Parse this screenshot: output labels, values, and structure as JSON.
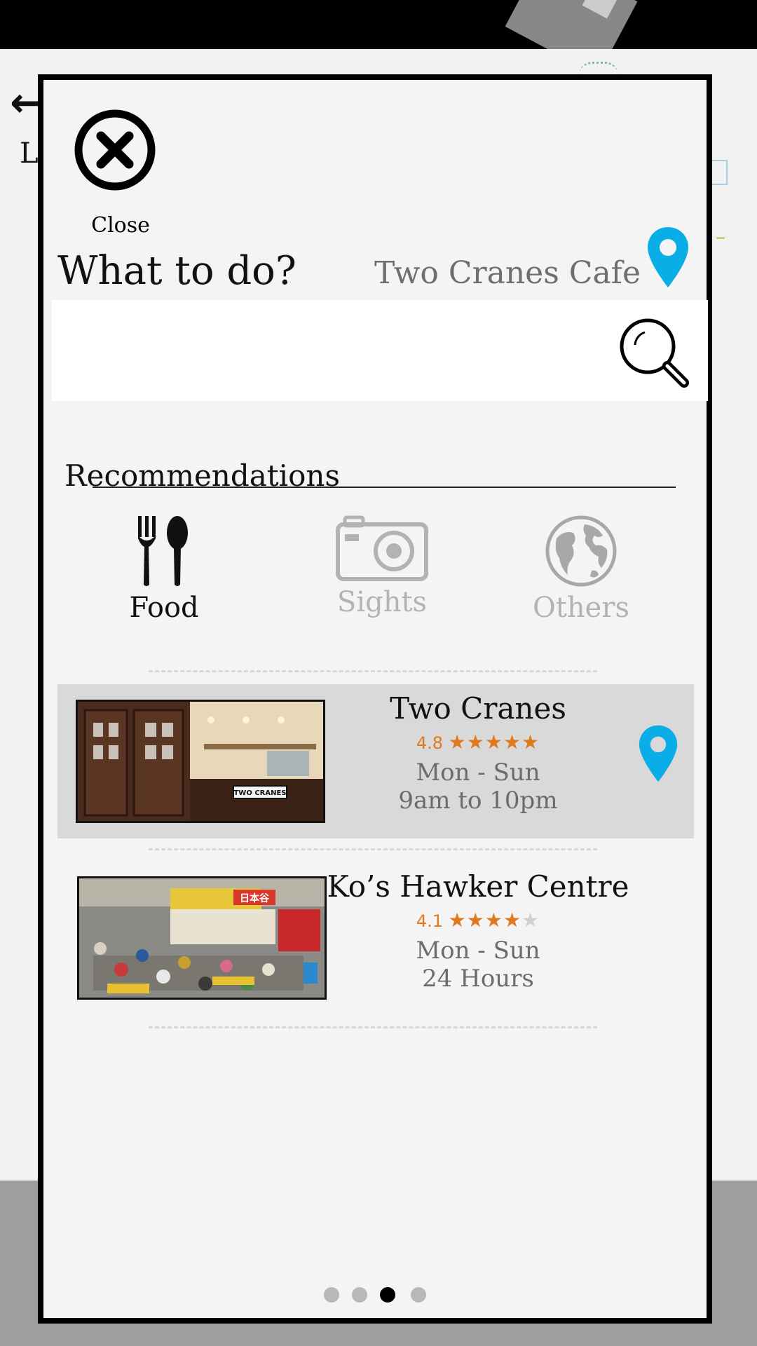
{
  "background": {
    "back_label": "L"
  },
  "close": {
    "label": "Close"
  },
  "header": {
    "title": "What to do?",
    "location_name": "Two Cranes Cafe"
  },
  "search": {
    "value": "",
    "placeholder": ""
  },
  "recommendations": {
    "title": "Recommendations",
    "categories": [
      {
        "label": "Food",
        "icon": "fork-spoon-icon",
        "active": true
      },
      {
        "label": "Sights",
        "icon": "camera-icon",
        "active": false
      },
      {
        "label": "Others",
        "icon": "globe-icon",
        "active": false
      }
    ]
  },
  "places": [
    {
      "name": "Two Cranes",
      "rating": "4.8",
      "stars": 5,
      "days": "Mon - Sun",
      "hours": "9am to 10pm",
      "selected": true,
      "photo_sign": "TWO CRANES"
    },
    {
      "name": "Ko’s Hawker Centre",
      "rating": "4.1",
      "stars": 4,
      "days": "Mon - Sun",
      "hours": "24 Hours",
      "selected": false,
      "photo_sign": "日本谷"
    }
  ],
  "pager": {
    "count": 4,
    "active_index": 2
  },
  "colors": {
    "pin_blue": "#0aaee6",
    "rating_orange": "#e07a1f",
    "selected_row": "#d9d9d9"
  }
}
